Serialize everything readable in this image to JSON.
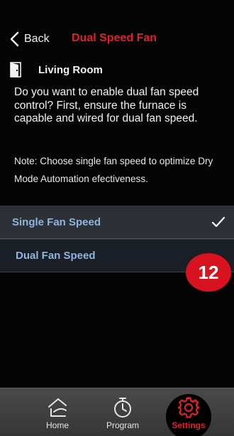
{
  "header": {
    "back_label": "Back",
    "title": "Dual Speed Fan"
  },
  "room": {
    "icon": "door-icon",
    "name": "Living Room"
  },
  "description": "Do you want to enable dual fan speed control? First, ensure the furnace is capable and wired for dual fan speed.",
  "note": "Note: Choose single fan speed to optimize Dry Mode Automation efectiveness.",
  "options": [
    {
      "label": "Single Fan Speed",
      "selected": true
    },
    {
      "label": "Dual Fan Speed",
      "selected": false
    }
  ],
  "step_badge": "12",
  "nav": {
    "home": {
      "label": "Home",
      "icon": "home-icon"
    },
    "program": {
      "label": "Program",
      "icon": "timer-icon"
    },
    "settings": {
      "label": "Settings",
      "icon": "gear-icon",
      "active": true
    }
  },
  "colors": {
    "accent_red": "#e0202b",
    "option_text": "#8fb4dd",
    "background": "#050505"
  }
}
